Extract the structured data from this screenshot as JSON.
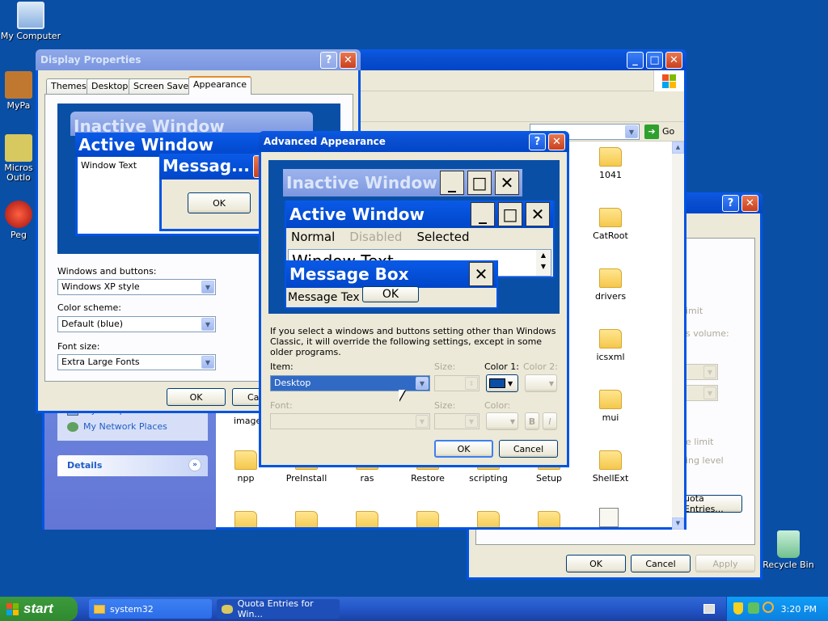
{
  "desktop": {
    "my_computer": "My Computer",
    "my_pictures": "MyPa",
    "outlook_l1": "Micros",
    "outlook_l2": "Outlo",
    "pegasus": "Peg",
    "recycle_bin": "Recycle Bin"
  },
  "explorer": {
    "go": "Go",
    "folders_col1": [
      "1041",
      "CatRoot",
      "drivers",
      "icsxml",
      "mui",
      "ShellExt"
    ],
    "folders_row": [
      "npp",
      "PreInstall",
      "ras",
      "Restore",
      "scripting",
      "Setup"
    ],
    "images_label": "images",
    "places": [
      "My Computer",
      "My Network Places"
    ],
    "details": "Details"
  },
  "display_props": {
    "title": "Display Properties",
    "tabs": [
      "Themes",
      "Desktop",
      "Screen Saver",
      "Appearance"
    ],
    "preview": {
      "inactive": "Inactive Window",
      "active": "Active Window",
      "window_text": "Window Text",
      "message": "Messag...",
      "ok": "OK"
    },
    "windows_buttons_label": "Windows and buttons:",
    "windows_buttons_value": "Windows XP style",
    "color_scheme_label": "Color scheme:",
    "color_scheme_value": "Default (blue)",
    "font_size_label": "Font size:",
    "font_size_value": "Extra Large Fonts",
    "ok": "OK",
    "cancel": "Ca"
  },
  "advanced": {
    "title": "Advanced Appearance",
    "preview": {
      "inactive": "Inactive Window",
      "active": "Active Window",
      "normal": "Normal",
      "disabled": "Disabled",
      "selected": "Selected",
      "window_text": "Window Text",
      "message_box": "Message Box",
      "message_text": "Message Tex",
      "ok": "OK"
    },
    "info": "If you select a windows and buttons setting other than Windows Classic, it will override the following settings, except in some older programs.",
    "item_label": "Item:",
    "item_value": "Desktop",
    "size_label": "Size:",
    "color1_label": "Color 1:",
    "color2_label": "Color 2:",
    "font_label": "Font:",
    "size2_label": "Size:",
    "color_label": "Color:",
    "bold": "B",
    "italic": "I",
    "ok": "OK",
    "cancel": "Cancel",
    "color1": "#0a4fa6"
  },
  "quota": {
    "frag1": "imit",
    "frag2": "s volume:",
    "frag3": "e limit",
    "frag4": "ing level",
    "entries_btn": "uota Entries...",
    "ok": "OK",
    "cancel": "Cancel",
    "apply": "Apply"
  },
  "taskbar": {
    "start": "start",
    "items": [
      "system32",
      "Quota Entries for Win..."
    ],
    "clock": "3:20 PM"
  }
}
